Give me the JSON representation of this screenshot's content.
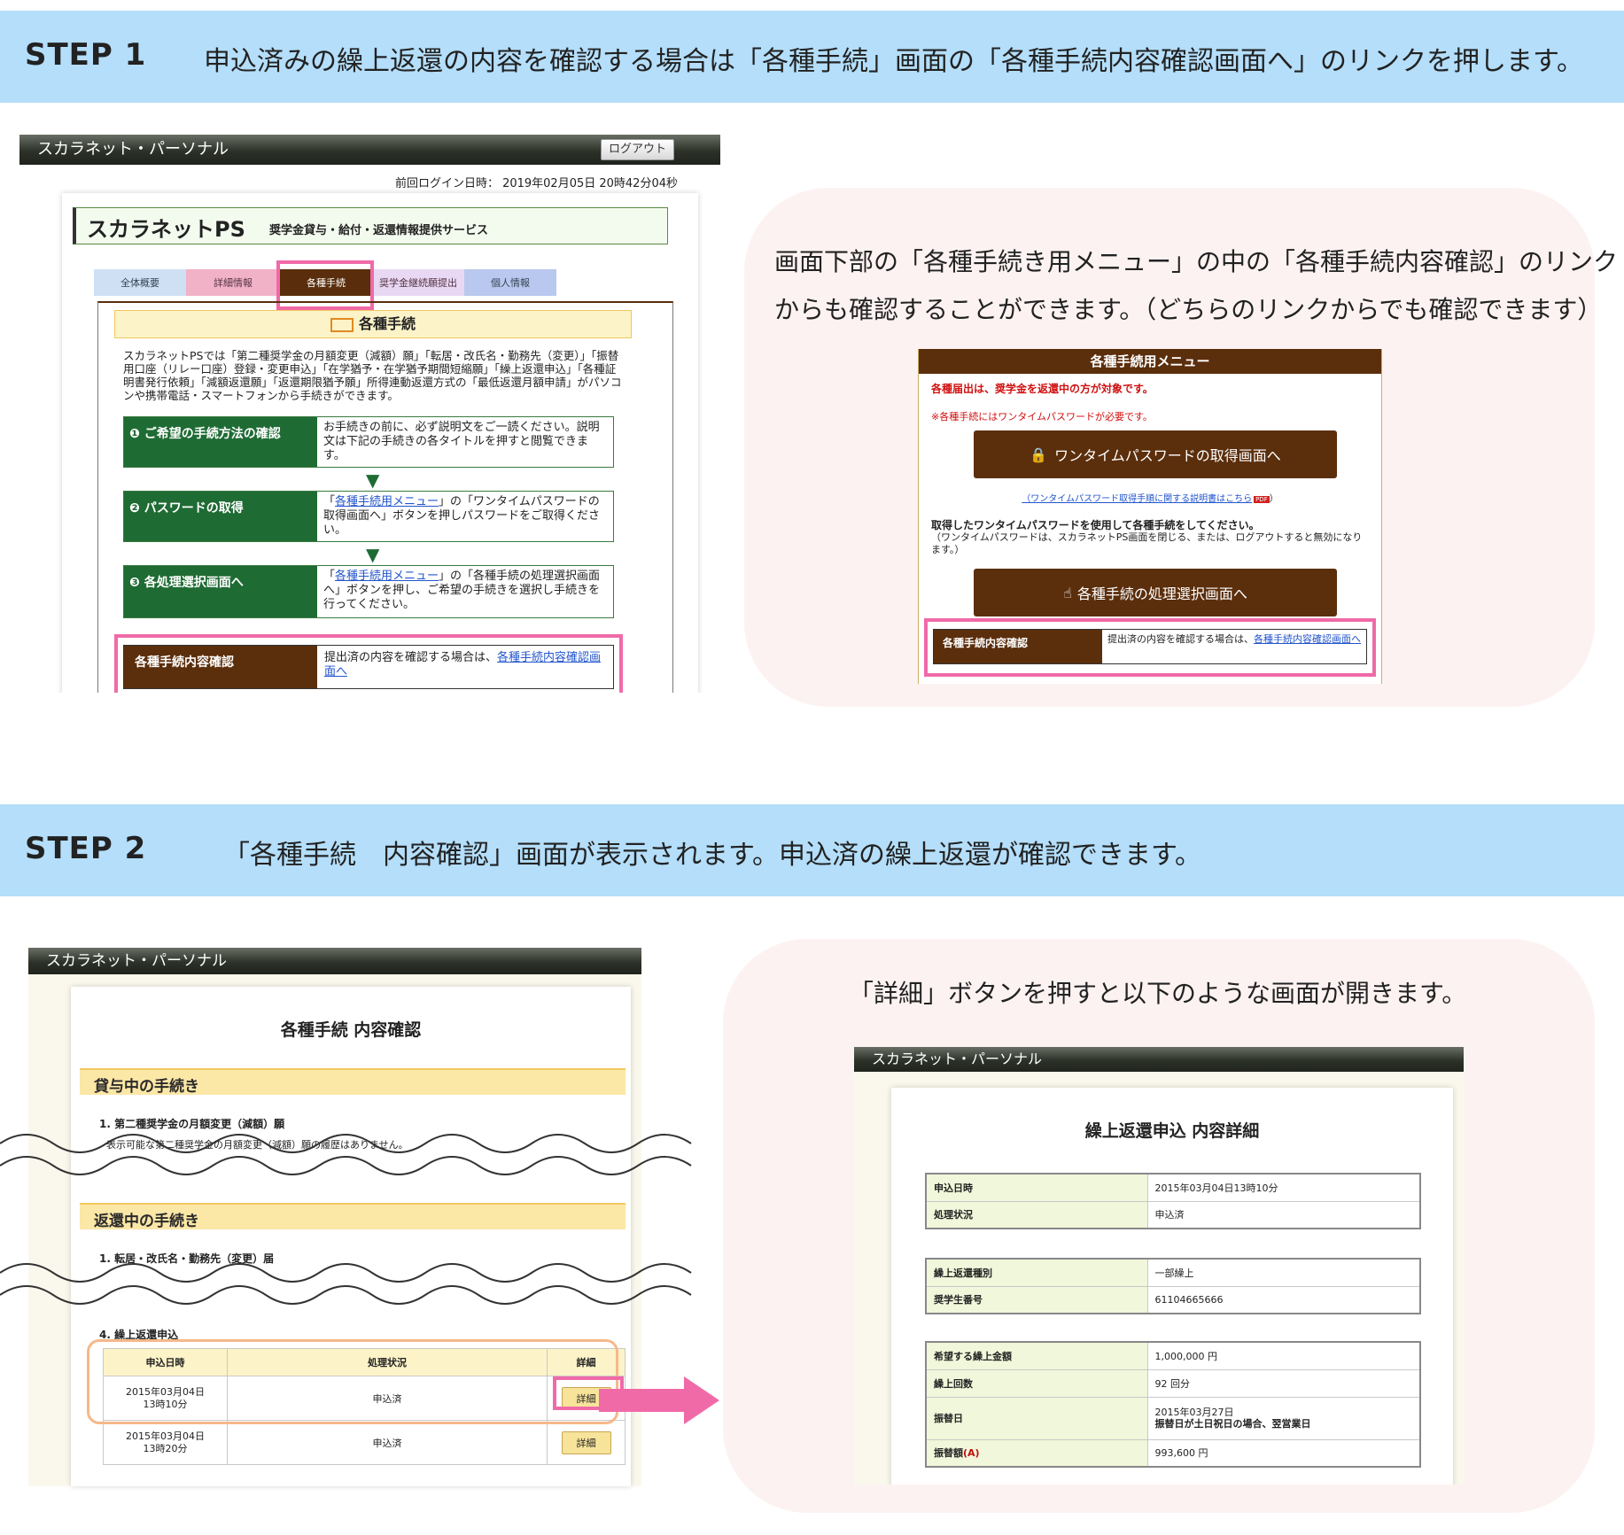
{
  "step1": {
    "label": "STEP 1",
    "text": "申込済みの繰上返還の内容を確認する場合は「各種手続」画面の「各種手続内容確認画面へ」のリンクを押します。",
    "note_line1": "画面下部の「各種手続き用メニュー」の中の「各種手続内容確認」のリンク",
    "note_line2": "からも確認することができます。（どちらのリンクからでも確認できます）"
  },
  "shot1": {
    "window_title": "スカラネット・パーソナル",
    "logout": "ログアウト",
    "last_login": "前回ログイン日時： 2019年02月05日 20時42分04秒",
    "brand": "スカラネットPS",
    "service": "奨学金貸与・給付・返還情報提供サービス",
    "tabs": [
      "全体概要",
      "詳細情報",
      "各種手続",
      "奨学金継続願提出",
      "個人情報"
    ],
    "section_title": "各種手続",
    "intro": "スカラネットPSでは「第二種奨学金の月額変更（減額）願」「転居・改氏名・勤務先（変更）」「振替用口座（リレー口座）登録・変更申込」「在学猶予・在学猶予期間短縮願」「繰上返還申込」「各種証明書発行依頼」「減額返還願」「返還期限猶予願」所得連動返還方式の「最低返還月額申請」がパソコンや携帯電話・スマートフォンから手続きができます。",
    "steps": [
      {
        "title": "❶ ご希望の手続方法の確認",
        "pre": "",
        "link": "",
        "text": "お手続きの前に、必ず説明文をご一読ください。説明文は下記の手続きの各タイトルを押すと閲覧できます。"
      },
      {
        "title": "❷ パスワードの取得",
        "pre": "「",
        "link": "各種手続用メニュー",
        "text": "」の「ワンタイムパスワードの取得画面へ」ボタンを押しパスワードをご取得ください。"
      },
      {
        "title": "❸ 各処理選択画面へ",
        "pre": "「",
        "link": "各種手続用メニュー",
        "text": "」の「各種手続の処理選択画面へ」ボタンを押し、ご希望の手続きを選択し手続きを行ってください。"
      }
    ],
    "confirm_label": "各種手続内容確認",
    "confirm_text": "提出済の内容を確認する場合は、",
    "confirm_link": "各種手続内容確認画面へ"
  },
  "menu": {
    "title": "各種手続用メニュー",
    "warn1": "各種届出は、奨学金を返還中の方が対象です。",
    "warn2": "※各種手続にはワンタイムパスワードが必要です。",
    "otp_button": "ワンタイムパスワードの取得画面へ",
    "otp_help": "（ワンタイムパスワード取得手順に関する説明書はこちら",
    "otp_help_end": "）",
    "pdf": "PDF",
    "note_bold": "取得したワンタイムパスワードを使用して各種手続をしてください。",
    "note": "（ワンタイムパスワードは、スカラネットPS画面を閉じる、または、ログアウトすると無効になります。）",
    "select_button": "各種手続の処理選択画面へ",
    "confirm_label": "各種手続内容確認",
    "confirm_text": "提出済の内容を確認する場合は、",
    "confirm_link": "各種手続内容確認画面へ"
  },
  "step2": {
    "label": "STEP 2",
    "text": "「各種手続　内容確認」画面が表示されます。申込済の繰上返還が確認できます。",
    "note": "「詳細」ボタンを押すと以下のような画面が開きます。"
  },
  "shot2": {
    "window_title": "スカラネット・パーソナル",
    "page_title": "各種手続 内容確認",
    "sec1": "貸与中の手続き",
    "item1": "1.  第二種奨学金の月額変更（減額）願",
    "item1_note": "表示可能な第二種奨学金の月額変更（減額）願の履歴はありません。",
    "sec2": "返還中の手続き",
    "item2": "1.  転居・改氏名・勤務先（変更）届",
    "item4": "4.  繰上返還申込",
    "headers": [
      "申込日時",
      "処理状況",
      "詳細"
    ],
    "rows": [
      {
        "date": "2015年03月04日",
        "time": "13時10分",
        "status": "申込済",
        "btn": "詳細"
      },
      {
        "date": "2015年03月04日",
        "time": "13時20分",
        "status": "申込済",
        "btn": "詳細"
      }
    ]
  },
  "shot3": {
    "window_title": "スカラネット・パーソナル",
    "page_title": "繰上返還申込 内容詳細",
    "t1": [
      [
        "申込日時",
        "2015年03月04日13時10分"
      ],
      [
        "処理状況",
        "申込済"
      ]
    ],
    "t2": [
      [
        "繰上返還種別",
        "一部繰上"
      ],
      [
        "奨学生番号",
        "61104665666"
      ]
    ],
    "t3a": [
      [
        "希望する繰上金額",
        "1,000,000 円"
      ],
      [
        "繰上回数",
        "92 回分"
      ]
    ],
    "furikae": {
      "key": "振替日",
      "date": "2015年03月27日",
      "note": "振替日が土日祝日の場合、翌営業日"
    },
    "amount": {
      "key": "振替額",
      "mark": "(A)",
      "value": "993,600 円"
    }
  },
  "colors": {
    "step_bar": "#b4defa",
    "bubble": "#fdf2f2",
    "highlight": "#f06aa8",
    "brown": "#5b2e0c",
    "green": "#1f6b34",
    "section": "#fbe7a6"
  }
}
